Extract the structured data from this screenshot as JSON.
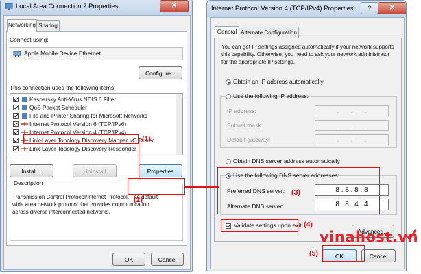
{
  "left_window": {
    "title": "Local Area Connection 2 Properties",
    "close_label": "✕",
    "tabs": [
      "Networking",
      "Sharing"
    ],
    "connect_using_label": "Connect using:",
    "adapter_name": "Apple Mobile Device Ethernet",
    "configure_label": "Configure...",
    "items_label": "This connection uses the following items:",
    "items": [
      {
        "label": "Kaspersky Anti-Virus NDIS 6 Filter",
        "checked": true
      },
      {
        "label": "QoS Packet Scheduler",
        "checked": true
      },
      {
        "label": "File and Printer Sharing for Microsoft Networks",
        "checked": true
      },
      {
        "label": "Internet Protocol Version 6 (TCP/IPv6)",
        "checked": true
      },
      {
        "label": "Internet Protocol Version 4 (TCP/IPv4)",
        "checked": true
      },
      {
        "label": "Link-Layer Topology Discovery Mapper I/O Driver",
        "checked": true
      },
      {
        "label": "Link-Layer Topology Discovery Responder",
        "checked": true
      }
    ],
    "install_label": "Install...",
    "uninstall_label": "Uninstall",
    "properties_label": "Properties",
    "description_title": "Description",
    "description_text": [
      "Transmission Control Protocol/Internet Protocol. The default",
      "wide area network protocol that provides communication",
      "across diverse interconnected networks."
    ],
    "ok_label": "OK",
    "cancel_label": "Cancel"
  },
  "right_window": {
    "title": "Internet Protocol Version 4 (TCP/IPv4) Properties",
    "help_label": "?",
    "close_label": "✕",
    "tabs": [
      "General",
      "Alternate Configuration"
    ],
    "intro": [
      "You can get IP settings assigned automatically if your network supports",
      "this capability. Otherwise, you need to ask your network administrator",
      "for the appropriate IP settings."
    ],
    "ip_auto_label": "Obtain an IP address automatically",
    "ip_manual_label": "Use the following IP address:",
    "ip_address_label": "IP address:",
    "subnet_label": "Subnet mask:",
    "gateway_label": "Default gateway:",
    "empty_ip": ".       .       .",
    "dns_auto_label": "Obtain DNS server address automatically",
    "dns_manual_label": "Use the following DNS server addresses:",
    "preferred_dns_label": "Preferred DNS server:",
    "preferred_dns_value": "8 . 8 . 8 . 8",
    "alternate_dns_label": "Alternate DNS server:",
    "alternate_dns_value": "8 . 8 . 4 . 4",
    "validate_label": "Validate settings upon exit",
    "advanced_label": "Advanced...",
    "ok_label": "OK",
    "cancel_label": "Cancel"
  },
  "annotations": [
    "(1)",
    "(2)",
    "(3)",
    "(4)",
    "(5)"
  ],
  "watermark": "vinahost.vn",
  "colors": {
    "annotation_red": "#e11414",
    "window_frame": "#7f96b3"
  }
}
